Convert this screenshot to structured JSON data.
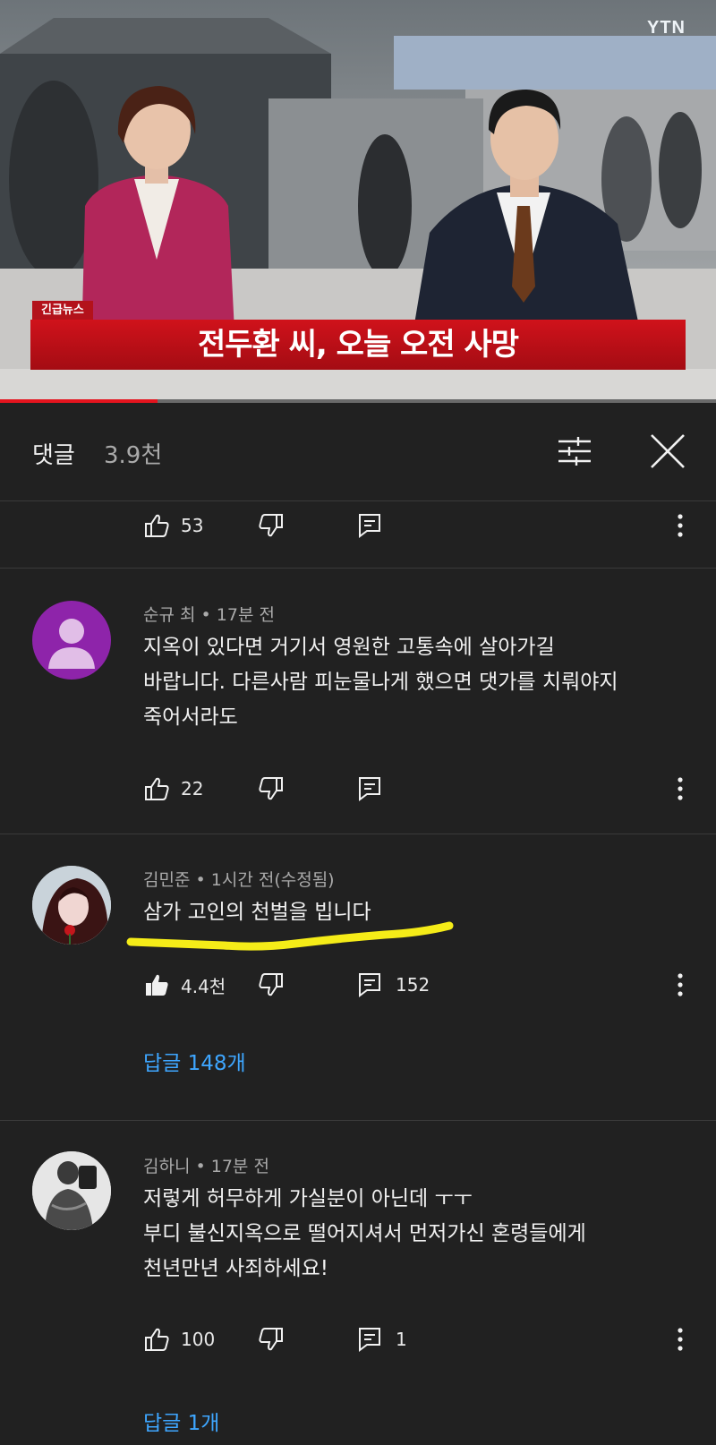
{
  "video": {
    "logo": "YTN",
    "breaking_tag": "긴급뉴스",
    "headline": "전두환 씨, 오늘 오전 사망",
    "progress_fraction": 0.22
  },
  "comments_panel": {
    "title": "댓글",
    "count": "3.9천",
    "sort_icon": "sliders-icon",
    "close_icon": "close-icon"
  },
  "top_actions": {
    "likes": "53"
  },
  "comments": [
    {
      "author": "순규 최",
      "time": "17분 전",
      "lines": [
        "지옥이 있다면 거기서 영원한 고통속에 살아가길",
        "바랍니다.  다른사람 피눈물나게 했으면 댓가를 치뤄야지",
        "죽어서라도"
      ],
      "likes": "22",
      "reply_count": "",
      "replies_label": ""
    },
    {
      "author": "김민준",
      "time": "1시간 전(수정됨)",
      "lines": [
        "삼가 고인의 천벌을 빕니다"
      ],
      "likes": "4.4천",
      "reply_count": "152",
      "replies_label": "답글 148개",
      "liked": true
    },
    {
      "author": "김하니",
      "time": "17분 전",
      "lines": [
        "저렇게 허무하게 가실분이 아닌데 ㅜㅜ",
        "부디 불신지옥으로 떨어지셔서 먼저가신 혼령들에게",
        "천년만년 사죄하세요!"
      ],
      "likes": "100",
      "reply_count": "1",
      "replies_label": "답글 1개"
    }
  ],
  "colors": {
    "accent_red": "#d0121b",
    "link_blue": "#3ea6ff",
    "highlight_yellow": "#f5ec18"
  }
}
